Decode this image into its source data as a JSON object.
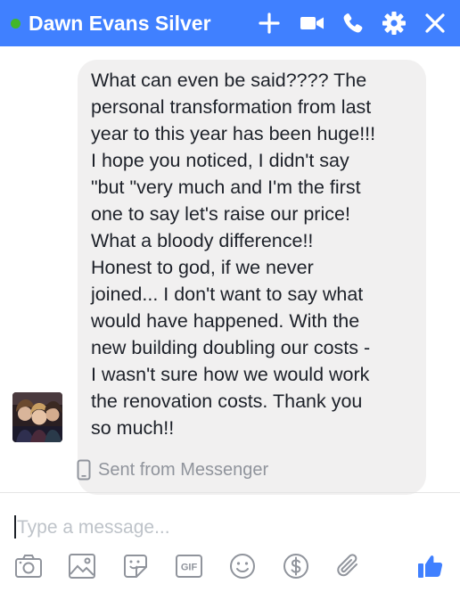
{
  "header": {
    "contact_name": "Dawn Evans Silver",
    "status": "online",
    "icons": [
      "plus-icon",
      "video-camera-icon",
      "phone-icon",
      "gear-icon",
      "close-icon"
    ],
    "colors": {
      "background": "#4080ff",
      "online": "#42b72a"
    }
  },
  "message": {
    "text": "What can even be said???? The\npersonal transformation from last\nyear to this year has been huge!!!\nI hope you noticed, I didn't say\n\"but \"very much and I'm the first\none to say let's raise our price!\nWhat a bloody difference!!\nHonest to god, if we never\njoined... I don't want to say what\nwould have happened. With the\nnew building doubling our costs -\nI wasn't sure how we would work\nthe renovation costs.  Thank you\nso much!!",
    "bubble_color": "#f1f0f0"
  },
  "sent_from": {
    "label": "Sent from Messenger",
    "icon": "mobile-phone-icon"
  },
  "composer": {
    "placeholder": "Type a message...",
    "toolbar": [
      "camera-icon",
      "image-icon",
      "sticker-icon",
      "gif-icon",
      "emoji-icon",
      "payment-icon",
      "attachment-icon",
      "like-icon"
    ],
    "gif_label": "GIF",
    "accent": "#4080ff"
  }
}
